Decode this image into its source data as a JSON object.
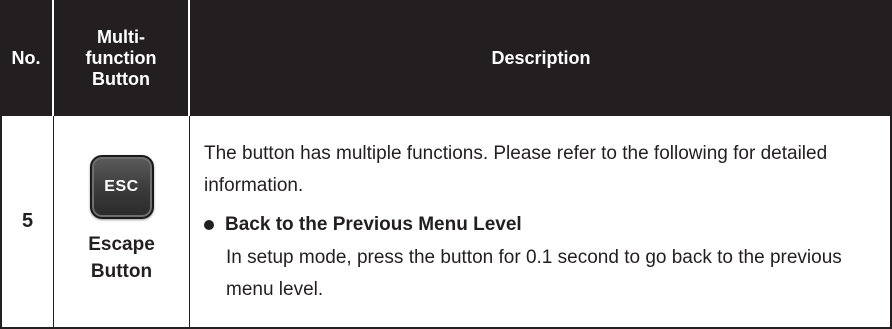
{
  "header": {
    "no_label": "No.",
    "button_label_lines": [
      "Multi-",
      "function",
      "Button"
    ],
    "description_label": "Description"
  },
  "rows": [
    {
      "no": "5",
      "keycap_label": "ESC",
      "button_name_lines": [
        "Escape",
        "Button"
      ],
      "intro": "The button has multiple functions. Please refer to the following for detailed information.",
      "bullets": [
        {
          "title": "Back to the Previous Menu Level",
          "text": "In setup mode, press the button for 0.1 second to go back to the previous menu level."
        }
      ]
    }
  ],
  "colors": {
    "header_bg": "#231f20",
    "header_text": "#ffffff",
    "keycap": "#3a3a3a"
  }
}
